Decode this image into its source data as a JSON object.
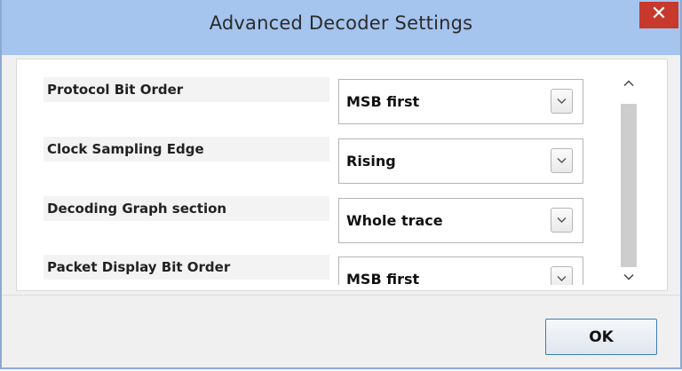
{
  "window": {
    "title": "Advanced Decoder Settings",
    "close_glyph": "✕"
  },
  "settings": [
    {
      "label": "Protocol Bit Order",
      "value": "MSB first"
    },
    {
      "label": "Clock Sampling Edge",
      "value": "Rising"
    },
    {
      "label": "Decoding Graph section",
      "value": "Whole trace"
    },
    {
      "label": "Packet Display Bit Order",
      "value": "MSB first"
    }
  ],
  "icons": {
    "dropdown": "chevron-down-icon",
    "scroll_up": "chevron-up-icon",
    "scroll_down": "chevron-down-icon",
    "close": "close-icon"
  },
  "colors": {
    "titlebar": "#a5c4ee",
    "close": "#c7392c",
    "window_border": "#8caad1",
    "ok_border": "#3c7fb1"
  },
  "footer": {
    "ok_label": "OK"
  }
}
